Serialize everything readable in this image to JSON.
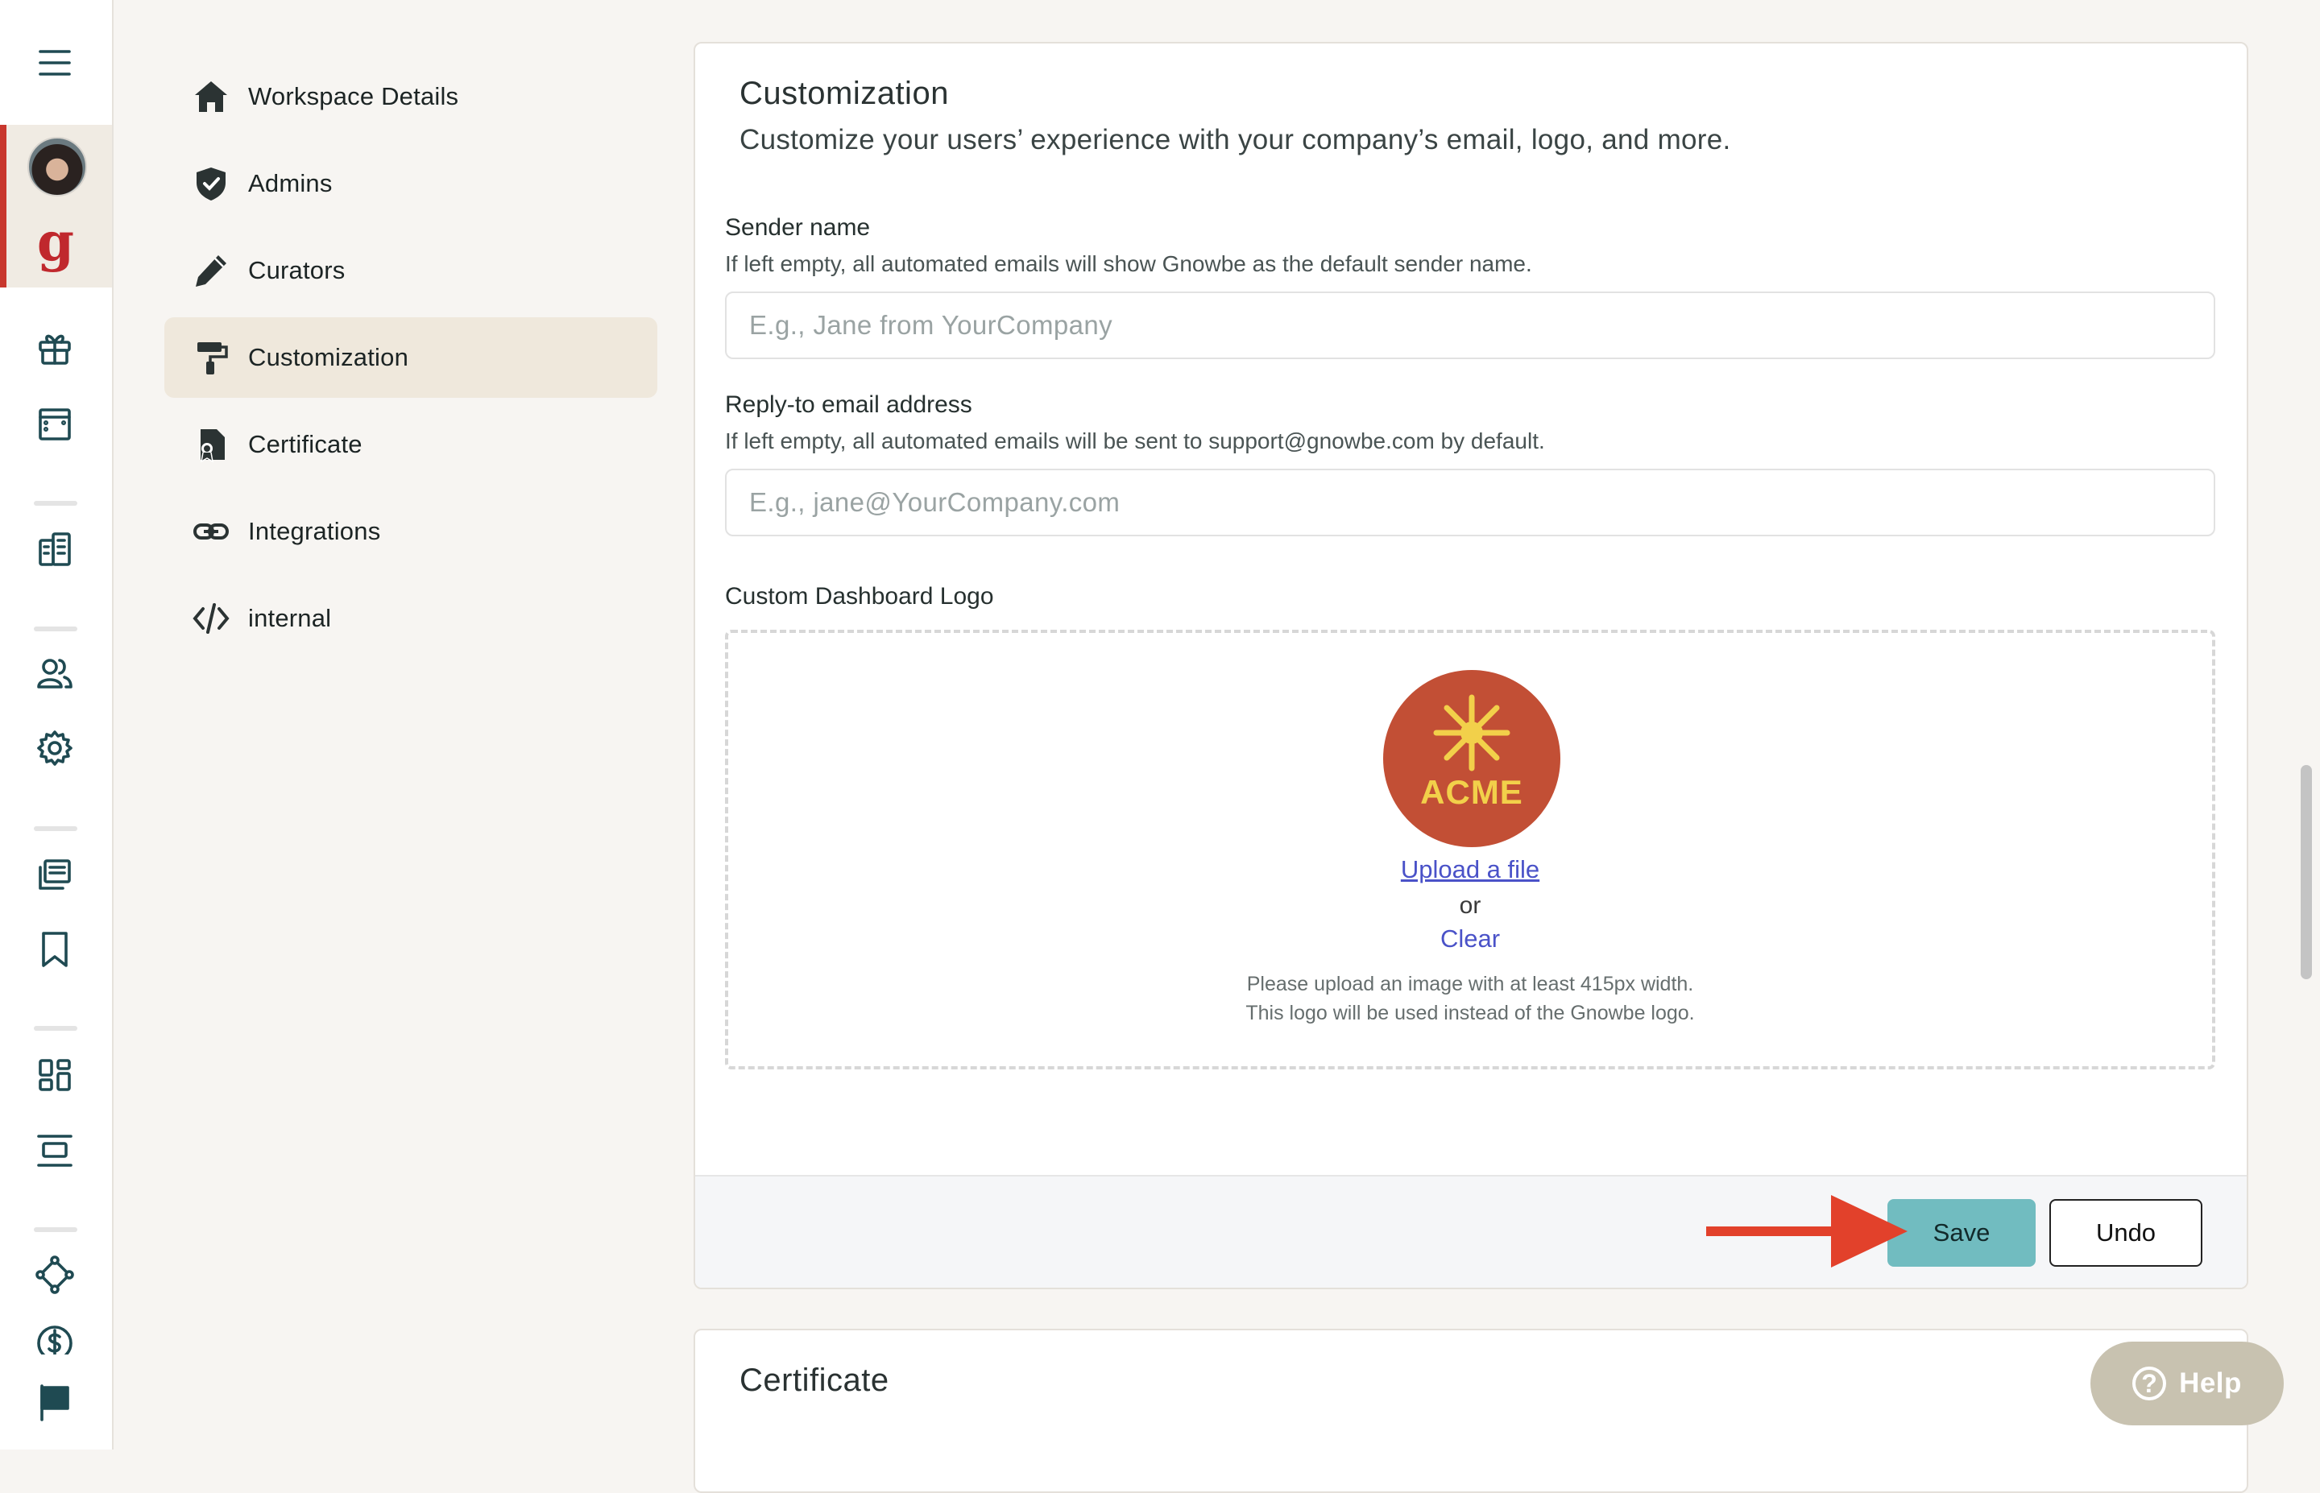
{
  "rail": {
    "icons": [
      "hamburger-menu-icon",
      "avatar",
      "gnowbe-logo-icon",
      "gift-icon",
      "layout-icon",
      "buildings-icon",
      "users-icon",
      "gear-icon",
      "library-icon",
      "bookmark-icon",
      "dashboard-icon",
      "align-center-icon",
      "network-icon",
      "dollar-icon",
      "flag-icon"
    ],
    "logo_letter": "g",
    "accent": "#c8372d"
  },
  "subnav": {
    "items": [
      {
        "label": "Workspace Details",
        "icon": "home-icon"
      },
      {
        "label": "Admins",
        "icon": "shield-check-icon"
      },
      {
        "label": "Curators",
        "icon": "pencil-icon"
      },
      {
        "label": "Customization",
        "icon": "paint-roller-icon",
        "active": true
      },
      {
        "label": "Certificate",
        "icon": "certificate-icon"
      },
      {
        "label": "Integrations",
        "icon": "link-icon"
      },
      {
        "label": "internal",
        "icon": "code-icon"
      }
    ]
  },
  "customization": {
    "title": "Customization",
    "subtitle": "Customize your users’ experience with your company’s email, logo, and more.",
    "sender_name": {
      "label": "Sender name",
      "help": "If left empty, all automated emails will show Gnowbe as the default sender name.",
      "placeholder": "E.g., Jane from YourCompany",
      "value": ""
    },
    "reply_to": {
      "label": "Reply-to email address",
      "help": "If left empty, all automated emails will be sent to support@gnowbe.com by default.",
      "placeholder": "E.g., jane@YourCompany.com",
      "value": ""
    },
    "logo": {
      "label": "Custom Dashboard Logo",
      "logo_text": "ACME",
      "logo_color": "#c24f35",
      "logo_text_color": "#f2d04a",
      "upload_link": "Upload a file",
      "or_text": "or",
      "clear_link": "Clear",
      "note_line1": "Please upload an image with at least 415px width.",
      "note_line2": "This logo will be used instead of the Gnowbe logo."
    },
    "footer": {
      "save_label": "Save",
      "undo_label": "Undo",
      "save_color": "#71bcc0",
      "annotation": "arrow-pointing-to-save"
    }
  },
  "certificate_card": {
    "title": "Certificate"
  },
  "help_button": {
    "label": "Help",
    "icon": "question-circle-icon"
  }
}
